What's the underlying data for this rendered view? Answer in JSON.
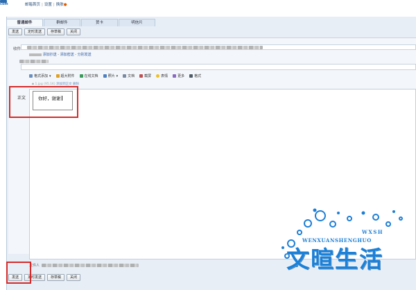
{
  "header": {
    "brand": "com",
    "links": [
      "邮箱首页",
      "设置",
      "换肤"
    ],
    "separator": "|"
  },
  "tabs": [
    {
      "label": "普通邮件",
      "active": true
    },
    {
      "label": "群邮件",
      "active": false
    },
    {
      "label": "贺卡",
      "active": false
    },
    {
      "label": "明信片",
      "active": false
    }
  ],
  "toolbar": {
    "send": "发送",
    "scheduled_send": "定时发送",
    "save_draft": "存草稿",
    "close": "关闭"
  },
  "compose": {
    "to_label": "收件人",
    "recipient_links": {
      "cc": "添加抄送",
      "bcc": "添加密送",
      "separate": "分别发送",
      "sep": "-"
    },
    "editor_toolbar": [
      {
        "label": "格式添加",
        "icon": "attachment-icon"
      },
      {
        "label": "超大附件",
        "icon": "large-attachment-icon"
      },
      {
        "label": "在线文档",
        "icon": "online-doc-icon"
      },
      {
        "label": "照片",
        "icon": "photo-icon"
      },
      {
        "label": "文档",
        "icon": "document-icon"
      },
      {
        "label": "截屏",
        "icon": "screenshot-icon"
      },
      {
        "label": "表情",
        "icon": "emoji-icon"
      },
      {
        "label": "更多",
        "icon": "more-icon"
      },
      {
        "label": "格式",
        "icon": "format-icon"
      }
    ],
    "attachment": {
      "name": "1.jpg",
      "size": "(95.1K)",
      "action_insert": "添加到正文",
      "action_delete": "删除"
    },
    "body_label": "正文",
    "body_text": "你好，谢谢",
    "sender_label": "发件人"
  },
  "watermark": {
    "english": "WENXUANSHENGHUO",
    "badge": "WXSH",
    "chinese": "文暄生活"
  },
  "colors": {
    "highlight_red": "#d42a2a",
    "accent_blue": "#1a80d8",
    "link_blue": "#2c5aa0"
  }
}
